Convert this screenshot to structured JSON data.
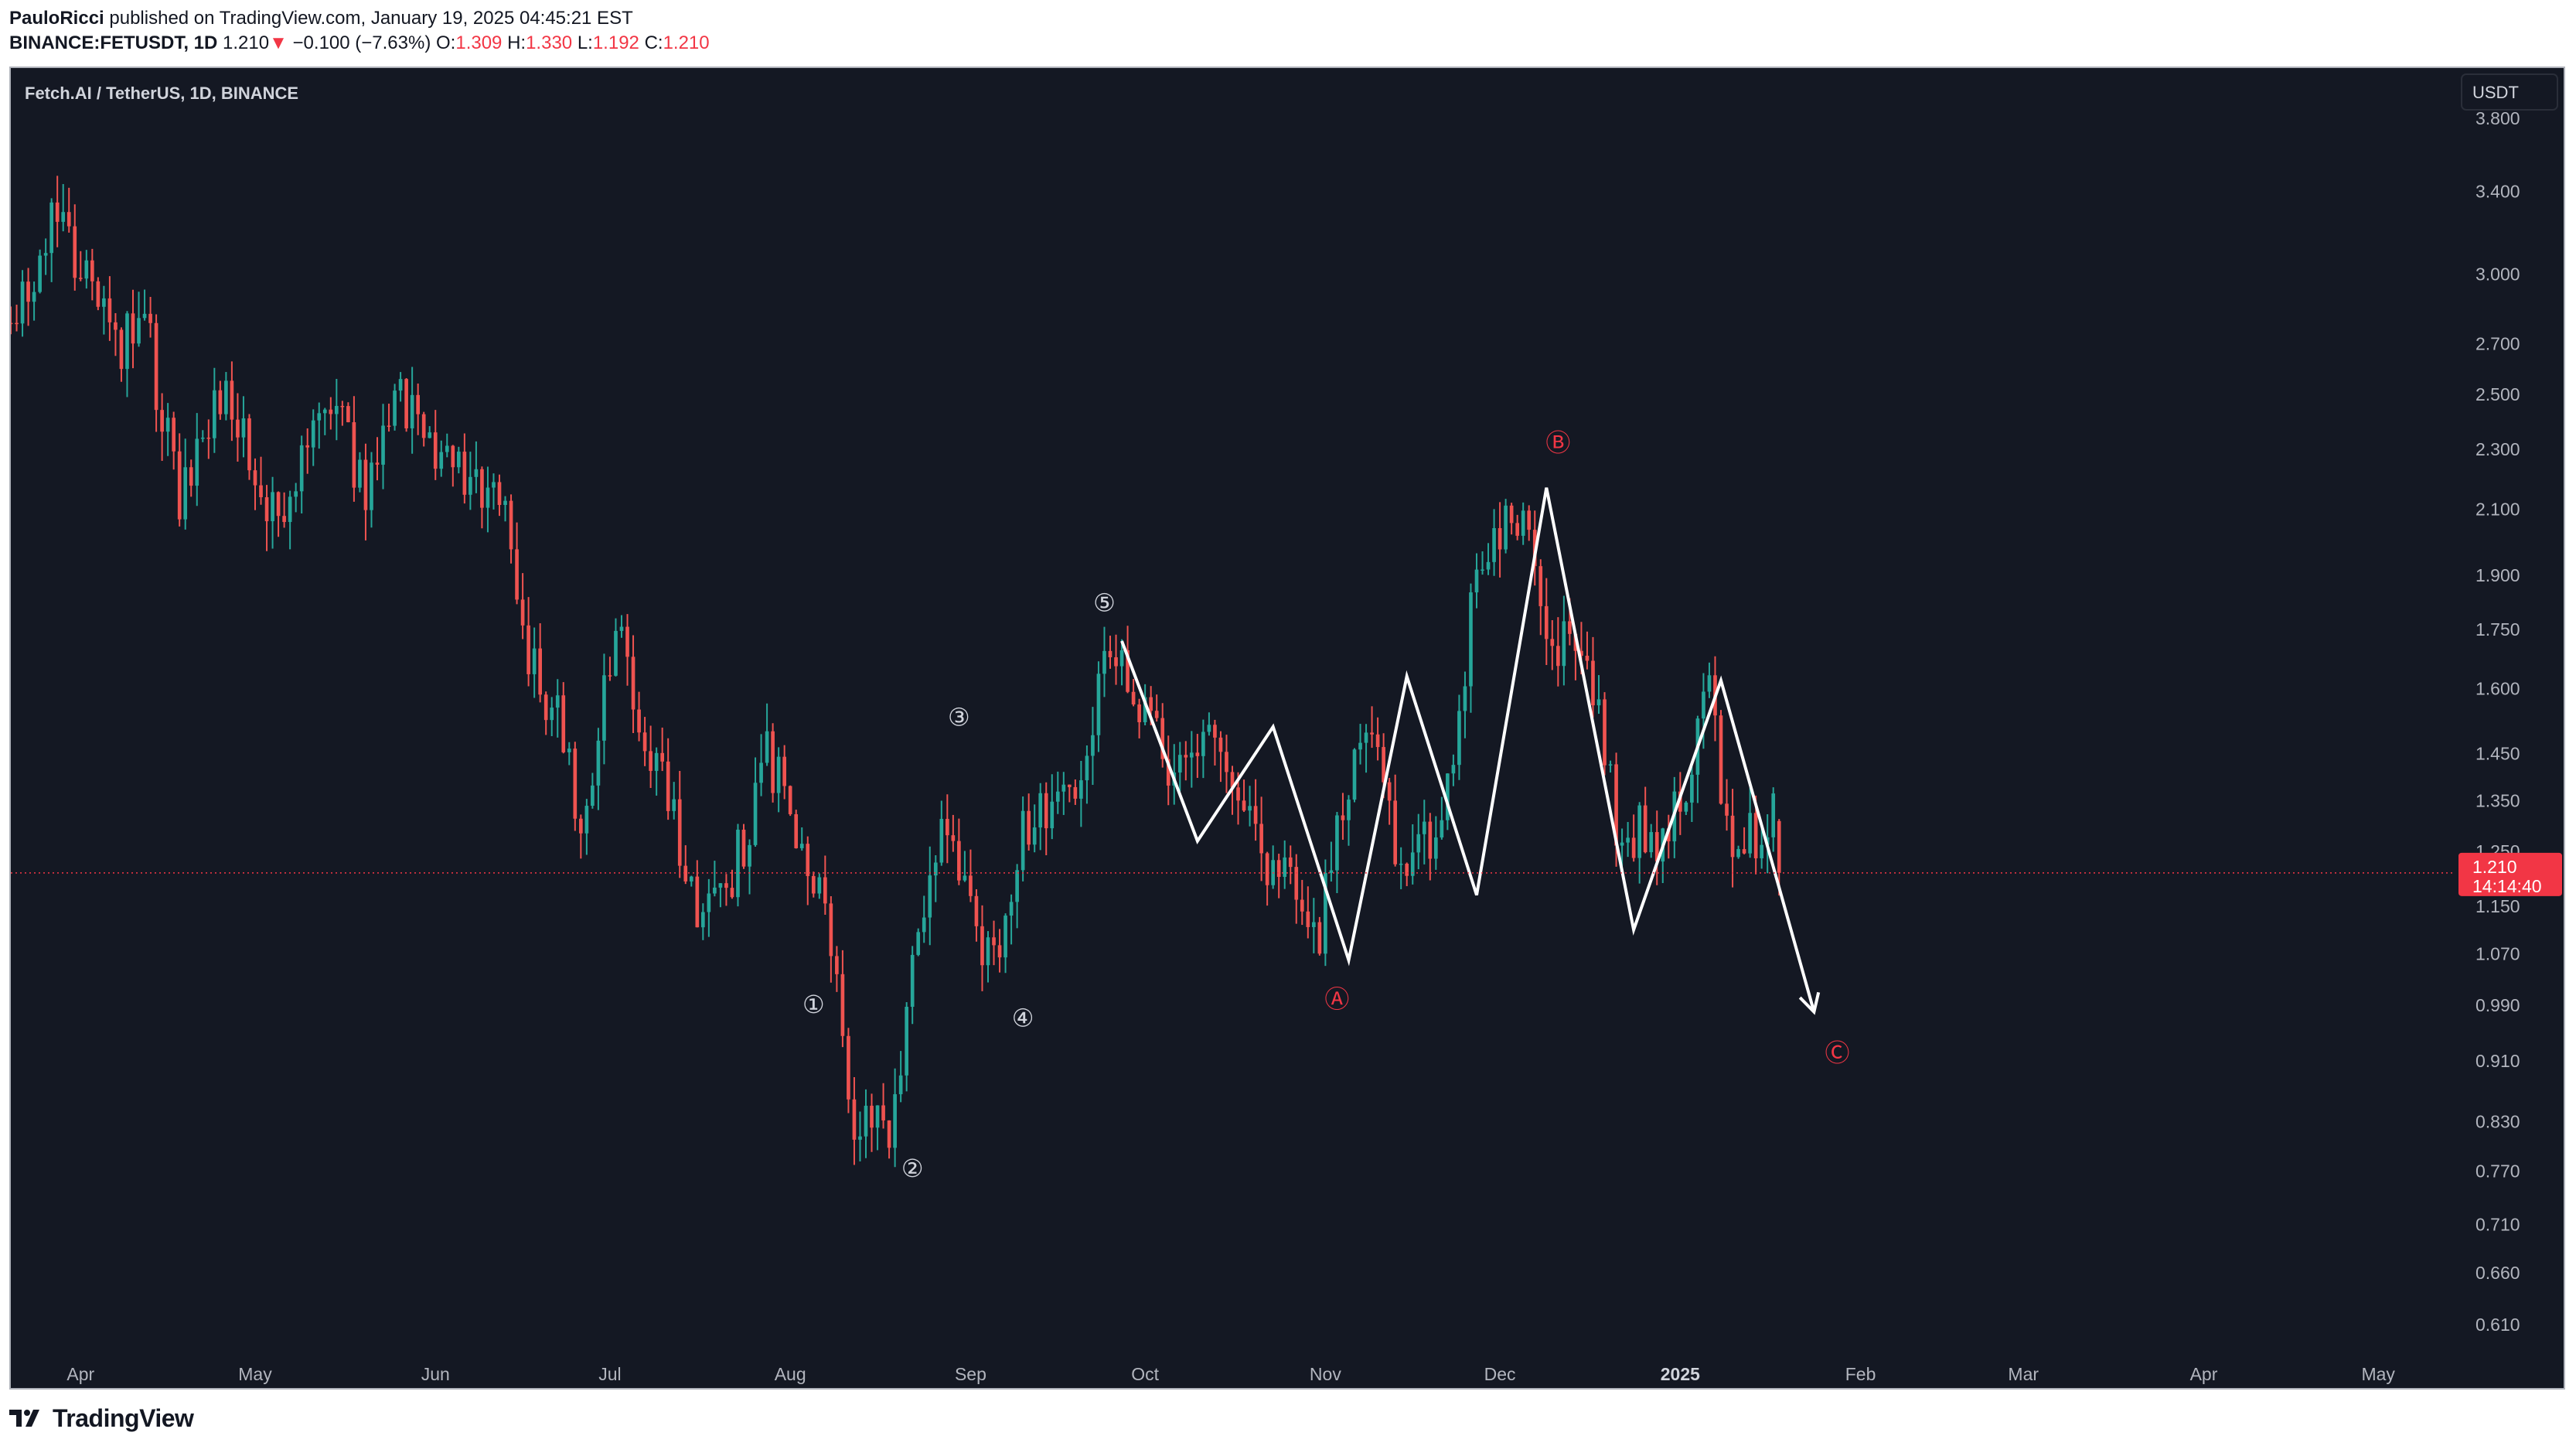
{
  "header": {
    "author": "PauloRicci",
    "published_text": "published on TradingView.com, January 19, 2025 04:45:21 EST",
    "symbol": "BINANCE:FETUSDT,",
    "interval": "1D",
    "last": "1.210",
    "change": "−0.100 (−7.63%)",
    "open_label": "O:",
    "open": "1.309",
    "high_label": "H:",
    "high": "1.330",
    "low_label": "L:",
    "low": "1.192",
    "close_label": "C:",
    "close": "1.210"
  },
  "footer": {
    "brand": "TradingView"
  },
  "chart_data": {
    "type": "candlestick",
    "title": "Fetch.AI / TetherUS, 1D, BINANCE",
    "currency": "USDT",
    "y_scale": "log",
    "ylim": [
      0.58,
      4.1
    ],
    "y_ticks": [
      "3.800",
      "3.400",
      "3.000",
      "2.700",
      "2.500",
      "2.300",
      "2.100",
      "1.900",
      "1.750",
      "1.600",
      "1.450",
      "1.350",
      "1.250",
      "1.150",
      "1.070",
      "0.990",
      "0.910",
      "0.830",
      "0.770",
      "0.710",
      "0.660",
      "0.610"
    ],
    "x_range": [
      "2024-03-20",
      "2025-05-14"
    ],
    "x_ticks": [
      {
        "label": "Apr",
        "date": "2024-04-01",
        "bold": false
      },
      {
        "label": "May",
        "date": "2024-05-01",
        "bold": false
      },
      {
        "label": "Jun",
        "date": "2024-06-01",
        "bold": false
      },
      {
        "label": "Jul",
        "date": "2024-07-01",
        "bold": false
      },
      {
        "label": "Aug",
        "date": "2024-08-01",
        "bold": false
      },
      {
        "label": "Sep",
        "date": "2024-09-01",
        "bold": false
      },
      {
        "label": "Oct",
        "date": "2024-10-01",
        "bold": false
      },
      {
        "label": "Nov",
        "date": "2024-11-01",
        "bold": false
      },
      {
        "label": "Dec",
        "date": "2024-12-01",
        "bold": false
      },
      {
        "label": "2025",
        "date": "2025-01-01",
        "bold": true
      },
      {
        "label": "Feb",
        "date": "2025-02-01",
        "bold": false
      },
      {
        "label": "Mar",
        "date": "2025-03-01",
        "bold": false
      },
      {
        "label": "Apr",
        "date": "2025-04-01",
        "bold": false
      },
      {
        "label": "May",
        "date": "2025-05-01",
        "bold": false
      }
    ],
    "price_line": {
      "value": 1.21,
      "label": "1.210",
      "countdown": "14:14:40"
    },
    "colors": {
      "up": "#26a69a",
      "down": "#ef5350",
      "background": "#141823",
      "axis_text": "#b2b5be",
      "annotation_red": "#f23645",
      "annotation_white": "#d1d4dc",
      "wave": "#ffffff"
    },
    "price_path": [
      [
        "2024-03-20",
        2.6
      ],
      [
        "2024-03-28",
        3.3
      ],
      [
        "2024-04-04",
        2.95
      ],
      [
        "2024-04-08",
        2.7
      ],
      [
        "2024-04-13",
        2.8
      ],
      [
        "2024-04-19",
        2.1
      ],
      [
        "2024-04-27",
        2.55
      ],
      [
        "2024-05-02",
        2.2
      ],
      [
        "2024-05-06",
        2.05
      ],
      [
        "2024-05-15",
        2.5
      ],
      [
        "2024-05-21",
        2.15
      ],
      [
        "2024-05-26",
        2.55
      ],
      [
        "2024-06-02",
        2.3
      ],
      [
        "2024-06-10",
        2.2
      ],
      [
        "2024-06-13",
        2.15
      ],
      [
        "2024-06-18",
        1.7
      ],
      [
        "2024-06-24",
        1.5
      ],
      [
        "2024-06-27",
        1.25
      ],
      [
        "2024-07-03",
        1.75
      ],
      [
        "2024-07-08",
        1.5
      ],
      [
        "2024-07-11",
        1.4
      ],
      [
        "2024-07-17",
        1.15
      ],
      [
        "2024-07-23",
        1.2
      ],
      [
        "2024-07-29",
        1.45
      ],
      [
        "2024-08-03",
        1.3
      ],
      [
        "2024-08-07",
        1.2
      ],
      [
        "2024-08-10",
        1.0
      ],
      [
        "2024-08-13",
        0.84
      ],
      [
        "2024-08-19",
        0.82
      ],
      [
        "2024-08-24",
        1.1
      ],
      [
        "2024-08-28",
        1.32
      ],
      [
        "2024-09-02",
        1.12
      ],
      [
        "2024-09-07",
        1.05
      ],
      [
        "2024-09-11",
        1.3
      ],
      [
        "2024-09-20",
        1.4
      ],
      [
        "2024-09-26",
        1.68
      ],
      [
        "2024-10-01",
        1.56
      ],
      [
        "2024-10-07",
        1.38
      ],
      [
        "2024-10-13",
        1.45
      ],
      [
        "2024-10-18",
        1.35
      ],
      [
        "2024-10-25",
        1.2
      ],
      [
        "2024-11-01",
        1.12
      ],
      [
        "2024-11-09",
        1.55
      ],
      [
        "2024-11-15",
        1.2
      ],
      [
        "2024-11-22",
        1.3
      ],
      [
        "2024-11-28",
        1.9
      ],
      [
        "2024-12-06",
        2.12
      ],
      [
        "2024-12-10",
        1.75
      ],
      [
        "2024-12-17",
        1.65
      ],
      [
        "2024-12-22",
        1.32
      ],
      [
        "2024-12-30",
        1.25
      ],
      [
        "2025-01-07",
        1.58
      ],
      [
        "2025-01-10",
        1.3
      ],
      [
        "2025-01-14",
        1.28
      ],
      [
        "2025-01-18",
        1.309
      ],
      [
        "2025-01-19",
        1.21
      ]
    ],
    "wave_lines": [
      [
        [
          "2024-09-27",
          1.72
        ],
        [
          "2024-10-10",
          1.27
        ],
        [
          "2024-10-23",
          1.51
        ],
        [
          "2024-11-05",
          1.06
        ],
        [
          "2024-11-15",
          1.63
        ],
        [
          "2024-11-27",
          1.17
        ],
        [
          "2024-12-09",
          2.17
        ],
        [
          "2024-12-24",
          1.11
        ],
        [
          "2025-01-08",
          1.62
        ],
        [
          "2025-01-24",
          0.98
        ]
      ]
    ],
    "annotations": [
      {
        "text": "①",
        "date": "2024-08-05",
        "price": 0.99,
        "color": "white"
      },
      {
        "text": "②",
        "date": "2024-08-22",
        "price": 0.772,
        "color": "white"
      },
      {
        "text": "③",
        "date": "2024-08-30",
        "price": 1.53,
        "color": "white"
      },
      {
        "text": "④",
        "date": "2024-09-10",
        "price": 0.97,
        "color": "white"
      },
      {
        "text": "⑤",
        "date": "2024-09-24",
        "price": 1.82,
        "color": "white"
      },
      {
        "text": "Ⓐ",
        "date": "2024-11-03",
        "price": 0.998,
        "color": "red"
      },
      {
        "text": "Ⓑ",
        "date": "2024-12-11",
        "price": 2.32,
        "color": "red"
      },
      {
        "text": "Ⓒ",
        "date": "2025-01-28",
        "price": 0.92,
        "color": "red"
      }
    ]
  }
}
